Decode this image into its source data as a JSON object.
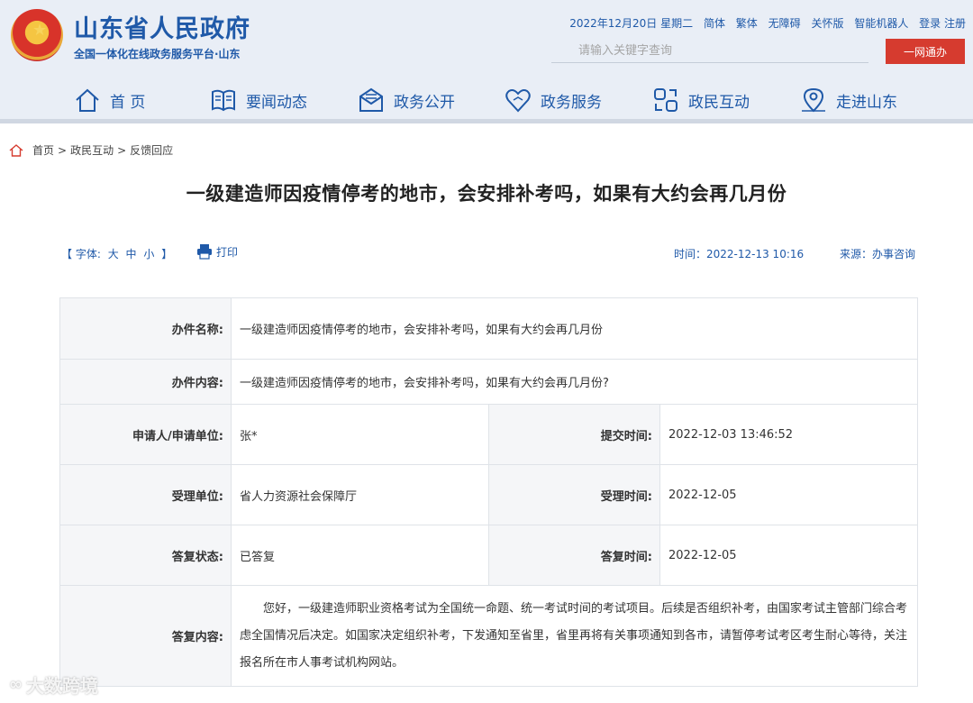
{
  "header": {
    "site_title": "山东省人民政府",
    "site_subtitle": "全国一体化在线政务服务平台·山东",
    "date": "2022年12月20日 星期二",
    "links": [
      "简体",
      "繁体",
      "无障碍",
      "关怀版",
      "智能机器人",
      "登录 注册"
    ],
    "search_placeholder": "请输入关键字查询",
    "search_button": "一网通办"
  },
  "nav": [
    {
      "label": "首 页",
      "icon": "home-icon"
    },
    {
      "label": "要闻动态",
      "icon": "book-icon"
    },
    {
      "label": "政务公开",
      "icon": "mail-icon"
    },
    {
      "label": "政务服务",
      "icon": "heart-icon"
    },
    {
      "label": "政民互动",
      "icon": "interaction-icon"
    },
    {
      "label": "走进山东",
      "icon": "location-icon"
    }
  ],
  "breadcrumb": [
    "首页",
    "政民互动",
    "反馈回应"
  ],
  "article": {
    "title": "一级建造师因疫情停考的地市，会安排补考吗，如果有大约会再几月份",
    "font_size_label": "【 字体:",
    "font_large": "大",
    "font_medium": "中",
    "font_small": "小",
    "font_close": "】",
    "print_label": "打印",
    "time_label": "时间：2022-12-13 10:16",
    "source_label": "来源：办事咨询"
  },
  "table": {
    "name_label": "办件名称:",
    "name_value": "一级建造师因疫情停考的地市，会安排补考吗，如果有大约会再几月份",
    "content_label": "办件内容:",
    "content_value": "一级建造师因疫情停考的地市，会安排补考吗，如果有大约会再几月份?",
    "applicant_label": "申请人/申请单位:",
    "applicant_value": "张*",
    "submit_time_label": "提交时间:",
    "submit_time_value": "2022-12-03 13:46:52",
    "accept_unit_label": "受理单位:",
    "accept_unit_value": "省人力资源社会保障厅",
    "accept_time_label": "受理时间:",
    "accept_time_value": "2022-12-05",
    "reply_status_label": "答复状态:",
    "reply_status_value": "已答复",
    "reply_time_label": "答复时间:",
    "reply_time_value": "2022-12-05",
    "reply_content_label": "答复内容:",
    "reply_content_value": "您好，一级建造师职业资格考试为全国统一命题、统一考试时间的考试项目。后续是否组织补考，由国家考试主管部门综合考虑全国情况后决定。如国家决定组织补考，下发通知至省里，省里再将有关事项通知到各市，请暂停考试考区考生耐心等待，关注报名所在市人事考试机构网站。"
  },
  "watermark": "大数跨境",
  "colors": {
    "brand_blue": "#1f59a8",
    "button_red": "#d63b2f",
    "header_bg": "#e9eef6"
  }
}
